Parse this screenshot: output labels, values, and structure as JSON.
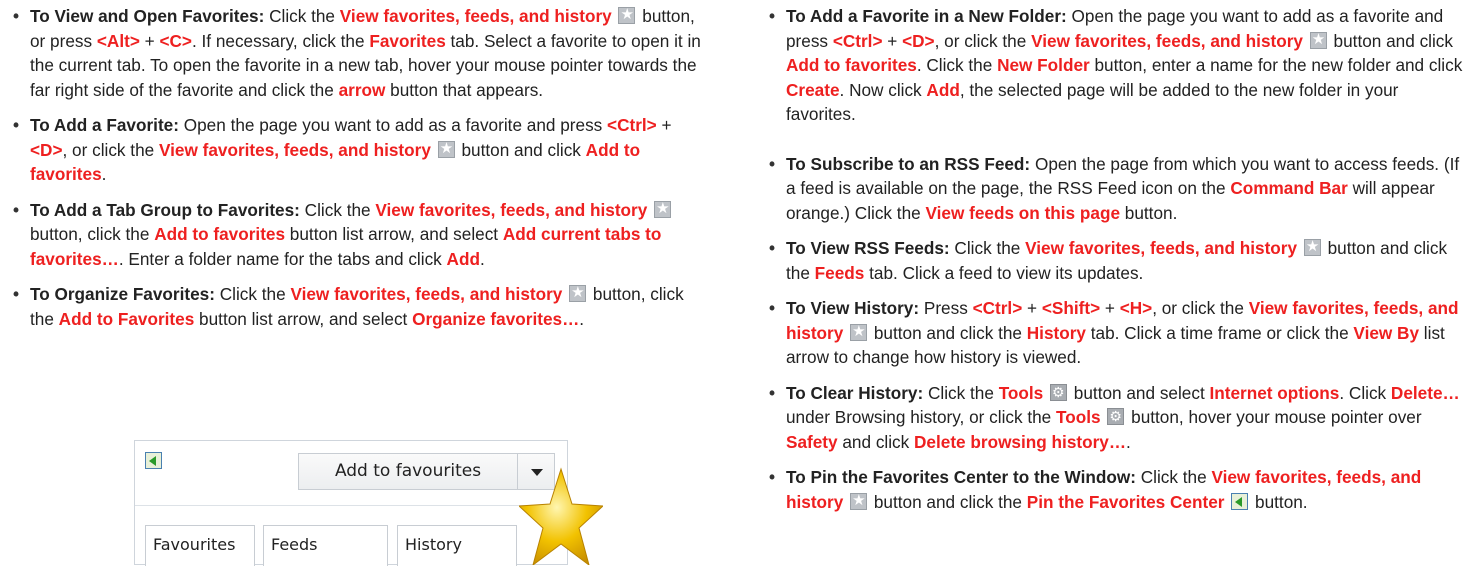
{
  "left": {
    "view_open": {
      "title": "To View and Open Favorites:",
      "s1": " Click the ",
      "hl1": "View favorites, feeds, and history",
      "s2": " button, or press ",
      "alt": "<Alt>",
      "plus": " + ",
      "c": "<C>",
      "s3": ". If necessary, click the ",
      "hl2": "Favorites",
      "s4": " tab. Select a favorite to open it in the current tab. To open the favorite in a new tab, hover your mouse pointer towards the far right side of the favorite and click the ",
      "hl3": "arrow",
      "s5": " button that appears."
    },
    "add_favorite": {
      "title": "To Add a Favorite:",
      "s1": " Open the page you want to add as a favorite and press ",
      "ctrl": "<Ctrl>",
      "plus": " + ",
      "d": "<D>",
      "s2": ", or click the ",
      "hl1": "View favorites, feeds, and history",
      "s3": " button and click ",
      "hl2": "Add to favorites",
      "s4": "."
    },
    "add_tab_group": {
      "title": "To Add a Tab Group to Favorites:",
      "s1": " Click the ",
      "hl1": "View favorites, feeds, and history",
      "s2": " button, click the ",
      "hl2": "Add to favorites",
      "s3": " button list arrow, and select ",
      "hl3": "Add current tabs to favorites…",
      "s4": ". Enter a folder name for the tabs and click ",
      "hl4": "Add",
      "s5": "."
    },
    "organize": {
      "title": "To Organize Favorites:",
      "s1": " Click the ",
      "hl1": "View favorites, feeds, and history",
      "s2": " button, click the ",
      "hl2": "Add to Favorites",
      "s3": " button list arrow, and select ",
      "hl3": "Organize favorites…",
      "s4": "."
    }
  },
  "right": {
    "new_folder": {
      "title": "To Add a Favorite in a New Folder:",
      "s1": " Open the page you want to add as a favorite and press ",
      "ctrl": "<Ctrl>",
      "plus": " + ",
      "d": "<D>",
      "s2": ", or click the ",
      "hl1": "View favorites, feeds, and history",
      "s3": " button and click ",
      "hl2": "Add to favorites",
      "s4": ". Click the ",
      "hl3": "New Folder",
      "s5": " button, enter a name for the new folder and click ",
      "hl4": "Create",
      "s6": ". Now click ",
      "hl5": "Add",
      "s7": ", the selected page will be added to the new folder in your favorites."
    },
    "subscribe_rss": {
      "title": "To Subscribe to an RSS Feed:",
      "s1": " Open the page from which you want to access feeds. (If a feed is available on the page, the RSS Feed icon on the ",
      "hl1": "Command Bar",
      "s2": " will appear orange.) Click the ",
      "hl2": "View feeds on this page",
      "s3": " button."
    },
    "view_rss": {
      "title": "To View RSS Feeds:",
      "s1": " Click the ",
      "hl1": "View favorites, feeds, and history",
      "s2": " button and click the ",
      "hl2": "Feeds",
      "s3": " tab. Click a feed to view its updates."
    },
    "view_history": {
      "title": "To View History:",
      "s1": " Press ",
      "ctrl": "<Ctrl>",
      "plus1": " + ",
      "shift": "<Shift>",
      "plus2": " + ",
      "h": "<H>",
      "s2": ", or click the ",
      "hl1": "View favorites, feeds, and history",
      "s3": " button and click the ",
      "hl2": "History",
      "s4": " tab. Click a time frame or click the ",
      "hl3": "View By",
      "s5": " list arrow to change how history is viewed."
    },
    "clear_history": {
      "title": "To Clear History:",
      "s1": " Click the ",
      "hl1": "Tools",
      "s2": " button and select ",
      "hl2": "Internet options",
      "s3": ". Click ",
      "hl3": "Delete…",
      "s4": " under Browsing history, or click the ",
      "hl4": "Tools",
      "s5": " button, hover your mouse pointer over ",
      "hl5": "Safety",
      "s6": " and click ",
      "hl6": "Delete browsing history…",
      "s7": "."
    },
    "pin_center": {
      "title": "To Pin the Favorites Center to the Window:",
      "s1": " Click the ",
      "hl1": "View favorites, feeds, and history",
      "s2": " button and click the ",
      "hl2": "Pin the Favorites Center",
      "s3": " button."
    }
  },
  "illustration": {
    "add_button_label": "Add to favourites",
    "tabs": [
      "Favourites",
      "Feeds",
      "History"
    ]
  },
  "colors": {
    "highlight": "#ee2020",
    "text": "#222222",
    "star_gold": "#f2c200"
  },
  "icons": [
    "favorites-star-icon",
    "tools-gear-icon",
    "pin-favorites-icon",
    "gold-star-icon"
  ]
}
